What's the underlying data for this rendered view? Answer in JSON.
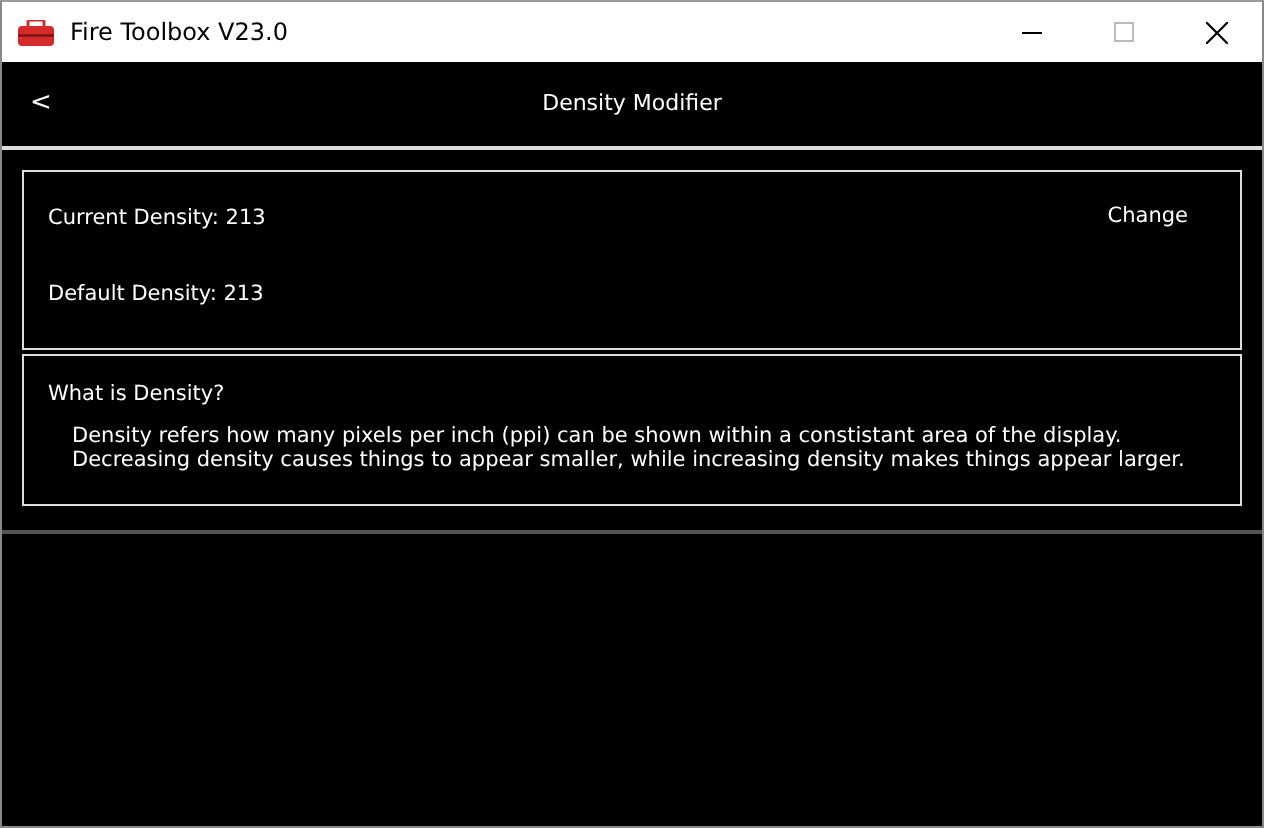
{
  "window": {
    "title": "Fire Toolbox V23.0"
  },
  "header": {
    "back": "<",
    "title": "Density Modifier"
  },
  "density": {
    "current": "Current Density: 213",
    "default": "Default Density: 213",
    "action": "Change"
  },
  "info": {
    "heading": "What is Density?",
    "lines": [
      "Density refers how many pixels per inch (ppi) can be shown within a constistant area of the display.",
      "Decreasing density causes things to appear smaller, while increasing density makes things appear larger."
    ]
  }
}
